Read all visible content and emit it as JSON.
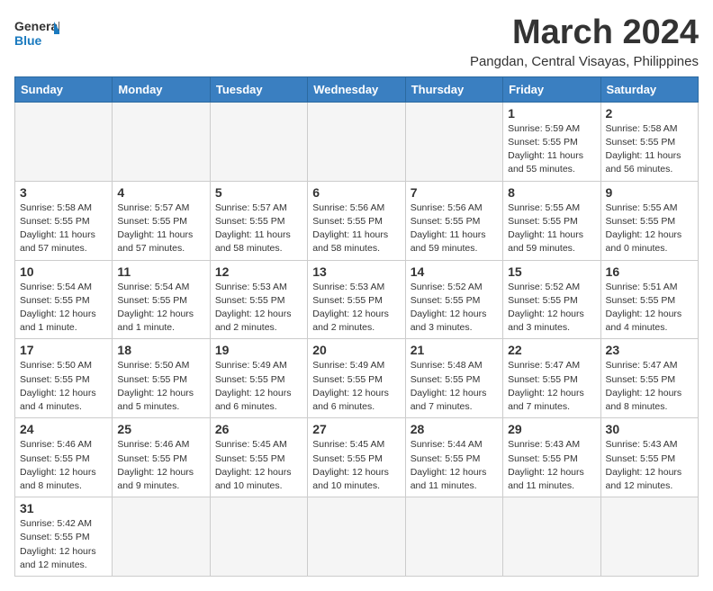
{
  "header": {
    "logo_general": "General",
    "logo_blue": "Blue",
    "title": "March 2024",
    "subtitle": "Pangdan, Central Visayas, Philippines"
  },
  "days_of_week": [
    "Sunday",
    "Monday",
    "Tuesday",
    "Wednesday",
    "Thursday",
    "Friday",
    "Saturday"
  ],
  "weeks": [
    [
      {
        "day": "",
        "info": "",
        "empty": true
      },
      {
        "day": "",
        "info": "",
        "empty": true
      },
      {
        "day": "",
        "info": "",
        "empty": true
      },
      {
        "day": "",
        "info": "",
        "empty": true
      },
      {
        "day": "",
        "info": "",
        "empty": true
      },
      {
        "day": "1",
        "info": "Sunrise: 5:59 AM\nSunset: 5:55 PM\nDaylight: 11 hours\nand 55 minutes."
      },
      {
        "day": "2",
        "info": "Sunrise: 5:58 AM\nSunset: 5:55 PM\nDaylight: 11 hours\nand 56 minutes."
      }
    ],
    [
      {
        "day": "3",
        "info": "Sunrise: 5:58 AM\nSunset: 5:55 PM\nDaylight: 11 hours\nand 57 minutes."
      },
      {
        "day": "4",
        "info": "Sunrise: 5:57 AM\nSunset: 5:55 PM\nDaylight: 11 hours\nand 57 minutes."
      },
      {
        "day": "5",
        "info": "Sunrise: 5:57 AM\nSunset: 5:55 PM\nDaylight: 11 hours\nand 58 minutes."
      },
      {
        "day": "6",
        "info": "Sunrise: 5:56 AM\nSunset: 5:55 PM\nDaylight: 11 hours\nand 58 minutes."
      },
      {
        "day": "7",
        "info": "Sunrise: 5:56 AM\nSunset: 5:55 PM\nDaylight: 11 hours\nand 59 minutes."
      },
      {
        "day": "8",
        "info": "Sunrise: 5:55 AM\nSunset: 5:55 PM\nDaylight: 11 hours\nand 59 minutes."
      },
      {
        "day": "9",
        "info": "Sunrise: 5:55 AM\nSunset: 5:55 PM\nDaylight: 12 hours\nand 0 minutes."
      }
    ],
    [
      {
        "day": "10",
        "info": "Sunrise: 5:54 AM\nSunset: 5:55 PM\nDaylight: 12 hours\nand 1 minute."
      },
      {
        "day": "11",
        "info": "Sunrise: 5:54 AM\nSunset: 5:55 PM\nDaylight: 12 hours\nand 1 minute."
      },
      {
        "day": "12",
        "info": "Sunrise: 5:53 AM\nSunset: 5:55 PM\nDaylight: 12 hours\nand 2 minutes."
      },
      {
        "day": "13",
        "info": "Sunrise: 5:53 AM\nSunset: 5:55 PM\nDaylight: 12 hours\nand 2 minutes."
      },
      {
        "day": "14",
        "info": "Sunrise: 5:52 AM\nSunset: 5:55 PM\nDaylight: 12 hours\nand 3 minutes."
      },
      {
        "day": "15",
        "info": "Sunrise: 5:52 AM\nSunset: 5:55 PM\nDaylight: 12 hours\nand 3 minutes."
      },
      {
        "day": "16",
        "info": "Sunrise: 5:51 AM\nSunset: 5:55 PM\nDaylight: 12 hours\nand 4 minutes."
      }
    ],
    [
      {
        "day": "17",
        "info": "Sunrise: 5:50 AM\nSunset: 5:55 PM\nDaylight: 12 hours\nand 4 minutes."
      },
      {
        "day": "18",
        "info": "Sunrise: 5:50 AM\nSunset: 5:55 PM\nDaylight: 12 hours\nand 5 minutes."
      },
      {
        "day": "19",
        "info": "Sunrise: 5:49 AM\nSunset: 5:55 PM\nDaylight: 12 hours\nand 6 minutes."
      },
      {
        "day": "20",
        "info": "Sunrise: 5:49 AM\nSunset: 5:55 PM\nDaylight: 12 hours\nand 6 minutes."
      },
      {
        "day": "21",
        "info": "Sunrise: 5:48 AM\nSunset: 5:55 PM\nDaylight: 12 hours\nand 7 minutes."
      },
      {
        "day": "22",
        "info": "Sunrise: 5:47 AM\nSunset: 5:55 PM\nDaylight: 12 hours\nand 7 minutes."
      },
      {
        "day": "23",
        "info": "Sunrise: 5:47 AM\nSunset: 5:55 PM\nDaylight: 12 hours\nand 8 minutes."
      }
    ],
    [
      {
        "day": "24",
        "info": "Sunrise: 5:46 AM\nSunset: 5:55 PM\nDaylight: 12 hours\nand 8 minutes."
      },
      {
        "day": "25",
        "info": "Sunrise: 5:46 AM\nSunset: 5:55 PM\nDaylight: 12 hours\nand 9 minutes."
      },
      {
        "day": "26",
        "info": "Sunrise: 5:45 AM\nSunset: 5:55 PM\nDaylight: 12 hours\nand 10 minutes."
      },
      {
        "day": "27",
        "info": "Sunrise: 5:45 AM\nSunset: 5:55 PM\nDaylight: 12 hours\nand 10 minutes."
      },
      {
        "day": "28",
        "info": "Sunrise: 5:44 AM\nSunset: 5:55 PM\nDaylight: 12 hours\nand 11 minutes."
      },
      {
        "day": "29",
        "info": "Sunrise: 5:43 AM\nSunset: 5:55 PM\nDaylight: 12 hours\nand 11 minutes."
      },
      {
        "day": "30",
        "info": "Sunrise: 5:43 AM\nSunset: 5:55 PM\nDaylight: 12 hours\nand 12 minutes."
      }
    ],
    [
      {
        "day": "31",
        "info": "Sunrise: 5:42 AM\nSunset: 5:55 PM\nDaylight: 12 hours\nand 12 minutes."
      },
      {
        "day": "",
        "info": "",
        "empty": true
      },
      {
        "day": "",
        "info": "",
        "empty": true
      },
      {
        "day": "",
        "info": "",
        "empty": true
      },
      {
        "day": "",
        "info": "",
        "empty": true
      },
      {
        "day": "",
        "info": "",
        "empty": true
      },
      {
        "day": "",
        "info": "",
        "empty": true
      }
    ]
  ]
}
